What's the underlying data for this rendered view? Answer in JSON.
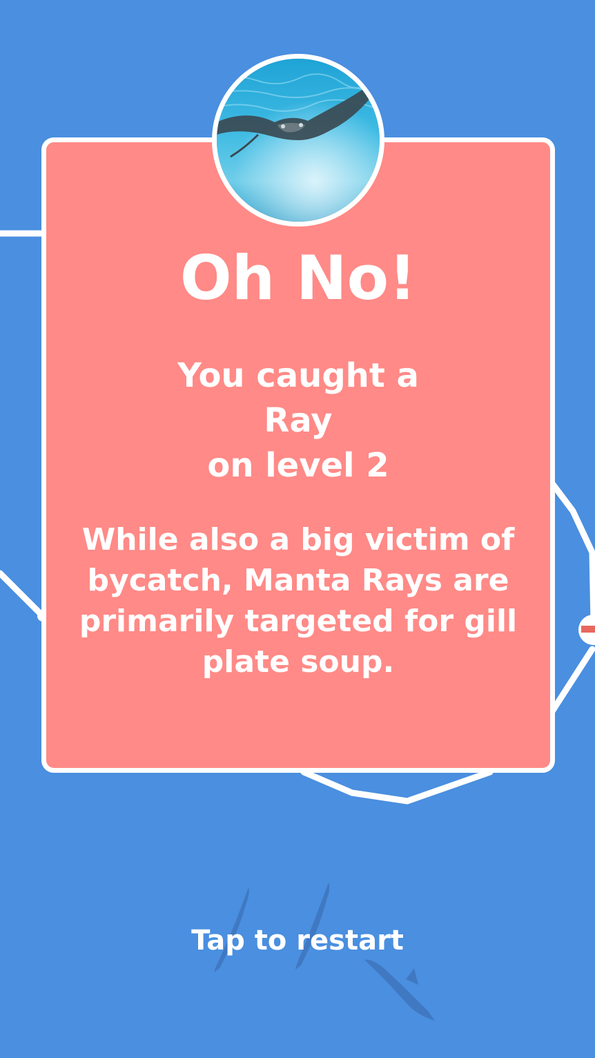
{
  "colors": {
    "background": "#4a8fe0",
    "card": "#ff8a87",
    "border": "#ffffff",
    "fish_shadow": "#3d70b8",
    "float_stripe": "#e8685f"
  },
  "popup": {
    "title": "Oh No!",
    "caught_line_1": "You caught a",
    "species": "Ray",
    "level_line": "on level 2",
    "fact": "While also a big victim of bycatch, Manta Rays are primarily targeted for gill plate soup.",
    "image_icon": "manta-ray-photo"
  },
  "footer": {
    "restart_label": "Tap to restart"
  }
}
